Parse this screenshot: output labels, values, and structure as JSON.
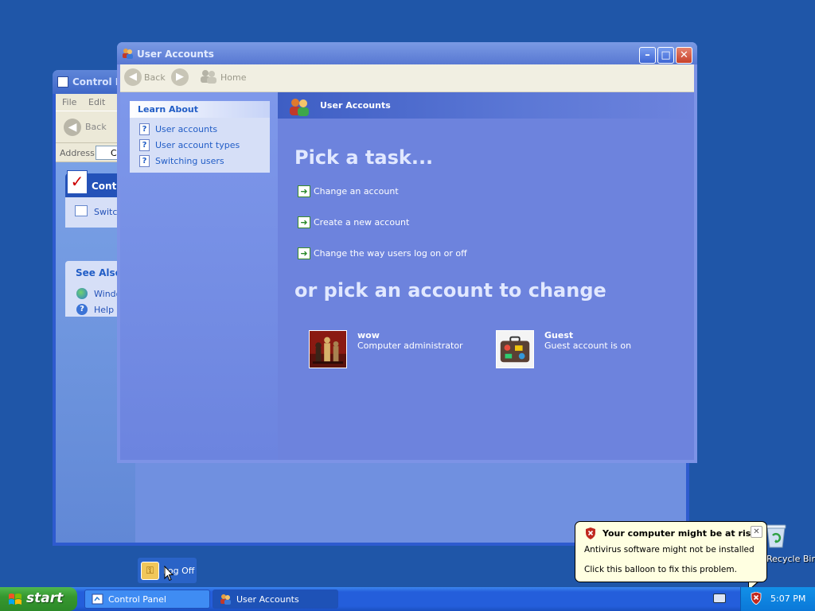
{
  "control_panel": {
    "title": "Control P",
    "menu": [
      "File",
      "Edit"
    ],
    "back_label": "Back",
    "address_label": "Address",
    "address_value": "C",
    "panel_title": "Contr",
    "panel_link": "Switch",
    "see_also_title": "See Also",
    "see_also_links": [
      "Windo",
      "Help a"
    ]
  },
  "user_accounts": {
    "title": "User Accounts",
    "toolbar": {
      "back_label": "Back",
      "home_label": "Home"
    },
    "learn_about": {
      "title": "Learn About",
      "items": [
        "User accounts",
        "User account types",
        "Switching users"
      ]
    },
    "header_title": "User Accounts",
    "pick_task": "Pick a task...",
    "tasks": [
      "Change an account",
      "Create a new account",
      "Change the way users log on or off"
    ],
    "pick_account": "or pick an account to change",
    "accounts": [
      {
        "name": "wow",
        "description": "Computer administrator",
        "picture": "chess-pieces"
      },
      {
        "name": "Guest",
        "description": "Guest account is on",
        "picture": "suitcase"
      }
    ]
  },
  "desktop": {
    "logoff_label": "Log Off",
    "recycle_bin_label": "Recycle Bin"
  },
  "balloon": {
    "title": "Your computer might be at risk",
    "line1": "Antivirus software might not be installed",
    "line2": "Click this balloon to fix this problem."
  },
  "taskbar": {
    "start_label": "start",
    "buttons": [
      "Control Panel",
      "User Accounts"
    ],
    "clock": "5:07 PM"
  },
  "colors": {
    "desktop": "#1f56a8",
    "taskbar": "#245edb",
    "start_button": "#36972f",
    "task_pane": "#6d83dd",
    "balloon": "#ffffe1"
  }
}
